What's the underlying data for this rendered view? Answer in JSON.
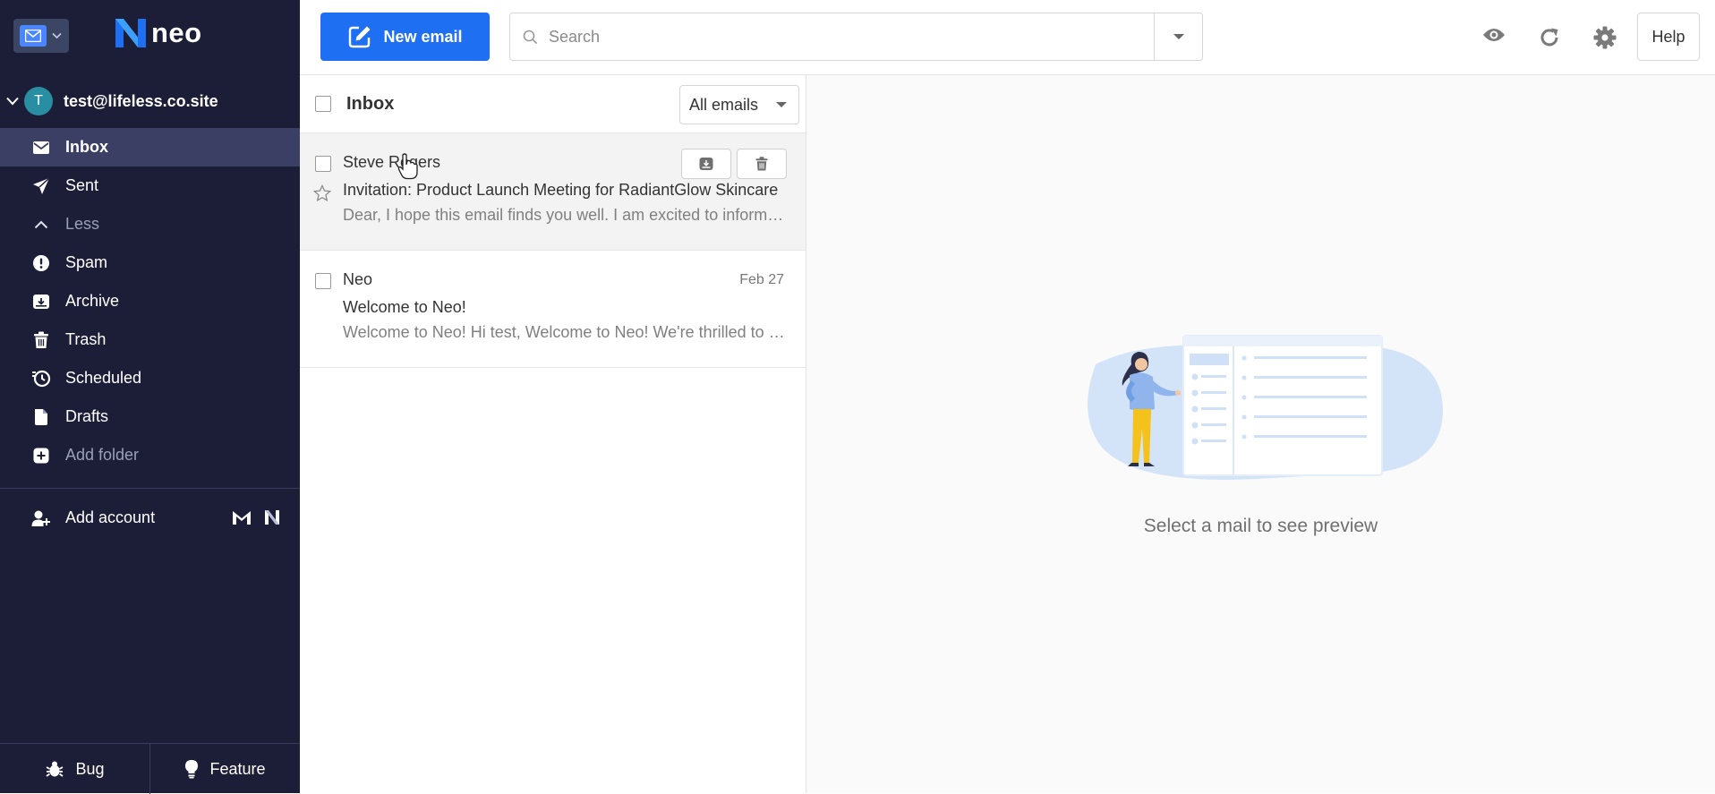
{
  "app": {
    "name": "neo"
  },
  "account": {
    "initial": "T",
    "email": "test@lifeless.co.site"
  },
  "sidebar": {
    "folders": [
      {
        "label": "Inbox",
        "icon": "envelope-icon",
        "active": true
      },
      {
        "label": "Sent",
        "icon": "paper-plane-icon"
      },
      {
        "label": "Less",
        "icon": "chevron-up-icon",
        "muted": true
      },
      {
        "label": "Spam",
        "icon": "alert-circle-icon"
      },
      {
        "label": "Archive",
        "icon": "archive-box-icon"
      },
      {
        "label": "Trash",
        "icon": "trash-icon"
      },
      {
        "label": "Scheduled",
        "icon": "clock-send-icon"
      },
      {
        "label": "Drafts",
        "icon": "draft-icon"
      },
      {
        "label": "Add folder",
        "icon": "plus-square-icon",
        "muted": true
      }
    ],
    "add_account": "Add account",
    "footer": {
      "bug": "Bug",
      "feature": "Feature"
    }
  },
  "topbar": {
    "new_email": "New email",
    "search_placeholder": "Search",
    "help": "Help"
  },
  "list": {
    "title": "Inbox",
    "filter": "All emails",
    "emails": [
      {
        "sender": "Steve Rogers",
        "subject": "Invitation: Product Launch Meeting for RadiantGlow Skincare",
        "preview": "Dear, I hope this email finds you well. I am excited to inform you",
        "date": ""
      },
      {
        "sender": "Neo",
        "subject": "Welcome to Neo!",
        "preview": "Welcome to Neo! Hi test, Welcome to Neo! We're thrilled to have you",
        "date": "Feb 27"
      }
    ]
  },
  "preview": {
    "empty_text": "Select a mail to see preview"
  },
  "colors": {
    "sidebar_bg": "#1c1e38",
    "sidebar_active": "#3b3f63",
    "primary_blue": "#1f6ff2",
    "avatar": "#2a8ea3",
    "illustration_blue": "#cfe0f7"
  }
}
